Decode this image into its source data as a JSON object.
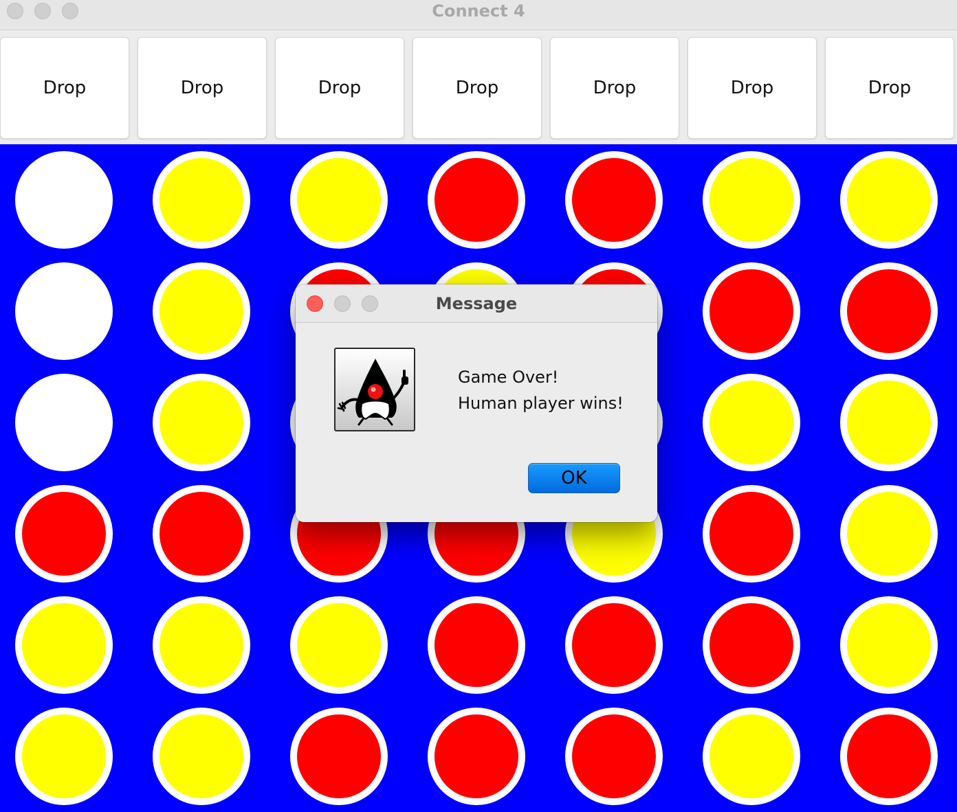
{
  "window": {
    "title": "Connect 4"
  },
  "columns": [
    {
      "drop_label": "Drop"
    },
    {
      "drop_label": "Drop"
    },
    {
      "drop_label": "Drop"
    },
    {
      "drop_label": "Drop"
    },
    {
      "drop_label": "Drop"
    },
    {
      "drop_label": "Drop"
    },
    {
      "drop_label": "Drop"
    }
  ],
  "board": {
    "rows": 6,
    "cols": 7,
    "cells": [
      [
        "empty",
        "yellow",
        "yellow",
        "red",
        "red",
        "yellow",
        "yellow"
      ],
      [
        "empty",
        "yellow",
        "red",
        "yellow",
        "red",
        "red",
        "red"
      ],
      [
        "empty",
        "yellow",
        "empty",
        "empty",
        "empty",
        "yellow",
        "yellow"
      ],
      [
        "red",
        "red",
        "red",
        "red",
        "yellow",
        "red",
        "yellow"
      ],
      [
        "yellow",
        "yellow",
        "yellow",
        "red",
        "red",
        "red",
        "yellow"
      ],
      [
        "yellow",
        "yellow",
        "red",
        "red",
        "red",
        "yellow",
        "red"
      ]
    ]
  },
  "colors": {
    "board": "#0000ff",
    "red": "#ff0000",
    "yellow": "#ffff00",
    "empty": "#ffffff",
    "ok_button": "#0a84ff"
  },
  "dialog": {
    "title": "Message",
    "icon": "java-duke-icon",
    "message_lines": [
      "Game Over!",
      "Human player wins!"
    ],
    "ok_label": "OK"
  }
}
